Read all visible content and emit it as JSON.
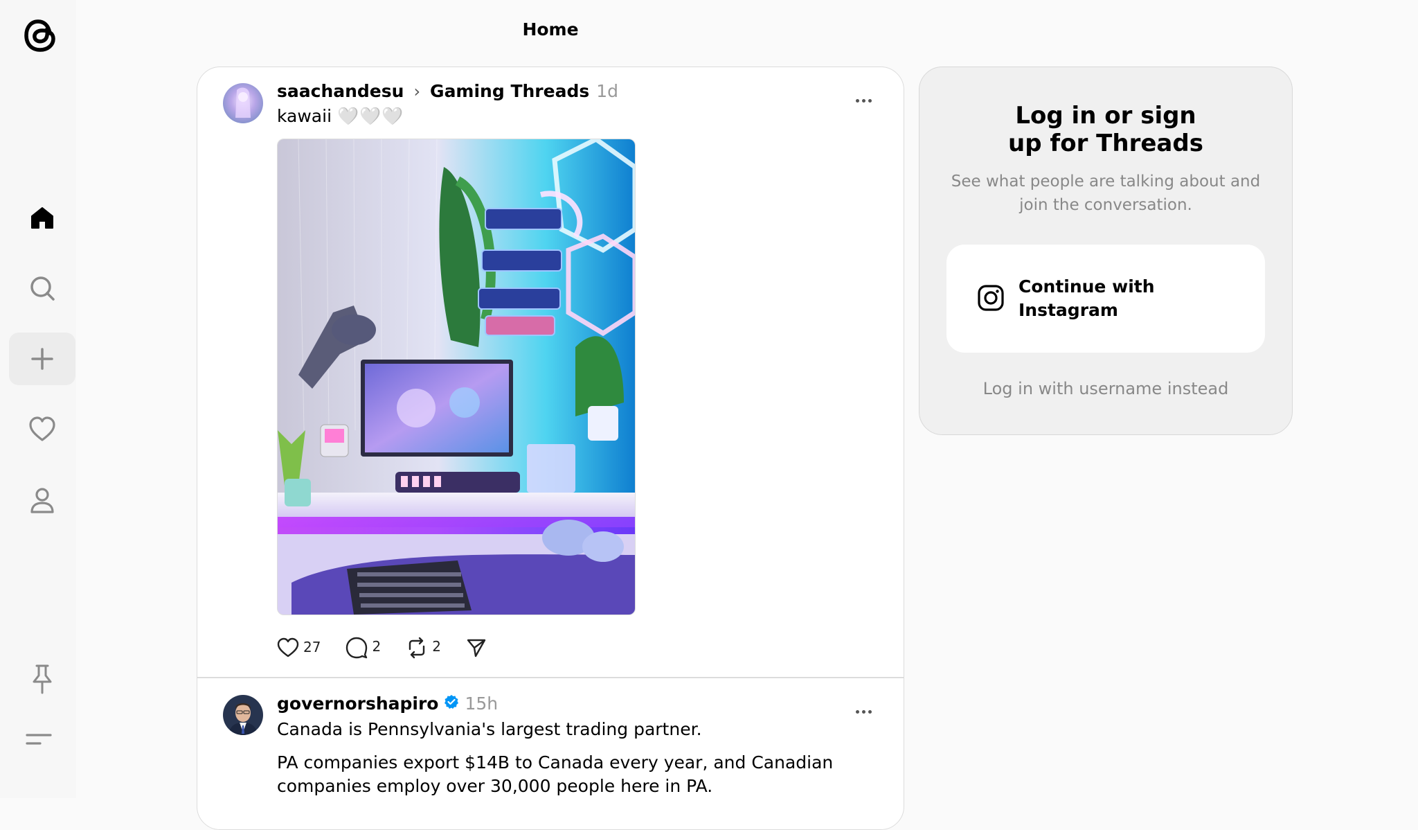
{
  "app": {
    "page_title": "Home",
    "nav": [
      {
        "icon": "home-icon",
        "active": true
      },
      {
        "icon": "search-icon"
      },
      {
        "icon": "plus-icon"
      },
      {
        "icon": "heart-icon"
      },
      {
        "icon": "profile-icon"
      },
      {
        "icon": "pin-icon"
      },
      {
        "icon": "menu-icon"
      }
    ]
  },
  "posts": [
    {
      "username": "saachandesu",
      "community": "Gaming Threads",
      "time": "1d",
      "text": "kawaii",
      "text_emoji": "🤍🤍🤍",
      "likes": "27",
      "comments": "2",
      "reposts": "2"
    },
    {
      "username": "governorshapiro",
      "time": "15h",
      "verified": true,
      "text": "Canada is Pennsylvania's largest trading partner.",
      "text2": "PA companies export $14B to Canada every year, and Canadian companies employ over 30,000 people here in PA."
    }
  ],
  "login": {
    "title": "Log in or sign up for Threads",
    "subtitle": "See what people are talking about and join the conversation.",
    "instagram_button": "Continue with Instagram",
    "username_link": "Log in with username instead"
  },
  "colors": {
    "background": "#fafafa",
    "panel": "#f0f0f0",
    "muted": "#888888",
    "verified": "#0095f6"
  }
}
